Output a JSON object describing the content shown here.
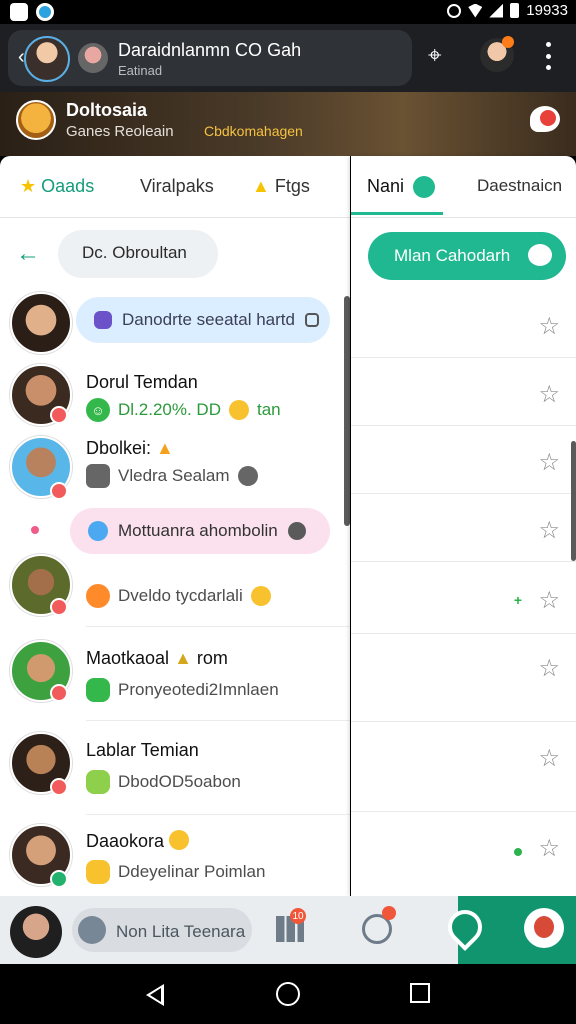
{
  "status_bar": {
    "time": "19933"
  },
  "app_bar": {
    "title": "Daraidnlanmn CO Gah",
    "subtitle": "Eatinad",
    "icons": [
      "back-icon",
      "user-avatar-icon",
      "map-pin-icon",
      "profile-icon",
      "more-icon"
    ]
  },
  "banner": {
    "title": "Doltosaia",
    "subtitle": "Ganes Reoleain",
    "chip": "Cbdkomahagen"
  },
  "left_tabs": {
    "items": [
      {
        "label": "Oaads",
        "active": true,
        "icon": "star-icon"
      },
      {
        "label": "Viralpaks",
        "active": false,
        "icon": ""
      },
      {
        "label": "Ftgs",
        "active": false,
        "icon": "triangle-icon"
      }
    ]
  },
  "search": {
    "text": "Dc. Obroultan"
  },
  "bubbles": {
    "top": "Danodrte seeatal hartd",
    "pink": "Mottuanra ahombolin"
  },
  "chats": [
    {
      "name": "Dorul Temdan",
      "preview": "Dl.2.20%. DD",
      "suffix": "tan",
      "chip": "green",
      "badge": "red"
    },
    {
      "name": "Dbolkei:",
      "preview": "Vledra Sealam",
      "suffix": "",
      "chip": "gray",
      "badge": "red"
    },
    {
      "name": "",
      "preview": "Dveldo tycdarlali",
      "suffix": "",
      "chip": "orange",
      "badge": "red"
    },
    {
      "name": "Maotkaoal",
      "preview": "Pronyeotedi2Imnlaen",
      "suffix": "rom",
      "chip": "green",
      "badge": "red"
    },
    {
      "name": "Lablar Temian",
      "preview": "DbodOD5oabon",
      "suffix": "",
      "chip": "lime",
      "badge": "red"
    },
    {
      "name": "Daaokora",
      "preview": "Ddeyelinar Poimlan",
      "suffix": "",
      "chip": "yellow",
      "badge": "green"
    }
  ],
  "right_panel": {
    "active_tab": "Nani",
    "other_tab": "Daestnaicn",
    "cta": "Mlan Cahodarh",
    "rows": [
      {
        "star": "☆",
        "extra": ""
      },
      {
        "star": "☆",
        "extra": ""
      },
      {
        "star": "☆",
        "extra": ""
      },
      {
        "star": "☆",
        "extra": ""
      },
      {
        "star": "☆",
        "extra": "plus"
      },
      {
        "star": "☆",
        "extra": ""
      },
      {
        "star": "☆",
        "extra": ""
      },
      {
        "star": "☆",
        "extra": "dot"
      }
    ]
  },
  "bottom_nav": {
    "search_label": "Non Lita Teenara",
    "badge": "10"
  },
  "colors": {
    "accent": "#1fb891",
    "dark_bar": "#1d1f22",
    "bubble_blue": "#dbeeff",
    "bubble_pink": "#fbe0ee"
  }
}
